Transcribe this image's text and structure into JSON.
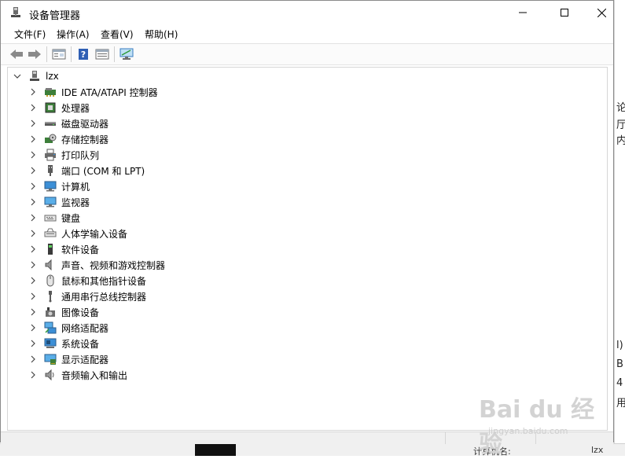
{
  "window": {
    "title": "设备管理器",
    "buttons": {
      "minimize": "—",
      "maximize": "☐",
      "close": "✕"
    }
  },
  "menu": [
    {
      "label": "文件(F)"
    },
    {
      "label": "操作(A)"
    },
    {
      "label": "查看(V)"
    },
    {
      "label": "帮助(H)"
    }
  ],
  "toolbar": {
    "icons": [
      "back-icon",
      "forward-icon",
      "properties-icon",
      "help-icon",
      "view-icon",
      "monitor-icon"
    ]
  },
  "tree": {
    "root": {
      "label": "lzx",
      "icon": "computer-icon",
      "expanded": true
    },
    "categories": [
      {
        "label": "IDE ATA/ATAPI 控制器",
        "icon": "ide-controller-icon"
      },
      {
        "label": "处理器",
        "icon": "processor-icon"
      },
      {
        "label": "磁盘驱动器",
        "icon": "disk-drive-icon"
      },
      {
        "label": "存储控制器",
        "icon": "storage-controller-icon"
      },
      {
        "label": "打印队列",
        "icon": "printer-icon"
      },
      {
        "label": "端口 (COM 和 LPT)",
        "icon": "port-icon"
      },
      {
        "label": "计算机",
        "icon": "computer-monitor-icon"
      },
      {
        "label": "监视器",
        "icon": "monitor-icon"
      },
      {
        "label": "键盘",
        "icon": "keyboard-icon"
      },
      {
        "label": "人体学输入设备",
        "icon": "hid-icon"
      },
      {
        "label": "软件设备",
        "icon": "software-device-icon"
      },
      {
        "label": "声音、视频和游戏控制器",
        "icon": "speaker-icon"
      },
      {
        "label": "鼠标和其他指针设备",
        "icon": "mouse-icon"
      },
      {
        "label": "通用串行总线控制器",
        "icon": "usb-icon"
      },
      {
        "label": "图像设备",
        "icon": "camera-icon"
      },
      {
        "label": "网络适配器",
        "icon": "network-adapter-icon"
      },
      {
        "label": "系统设备",
        "icon": "system-device-icon"
      },
      {
        "label": "显示适配器",
        "icon": "display-adapter-icon"
      },
      {
        "label": "音频输入和输出",
        "icon": "audio-io-icon"
      }
    ]
  },
  "background": {
    "right_fragments": [
      "论",
      "厅",
      "内",
      "l)",
      "B",
      "4",
      "用"
    ],
    "bottom_fragments": [
      "计算机名:",
      "lzx"
    ]
  },
  "watermark": {
    "main": "Bai du 经验",
    "sub": "jingyan.baidu.com"
  },
  "colors": {
    "accent": "#0078d7",
    "icon_blue": "#3c8fd6",
    "icon_green": "#2e9a3a"
  }
}
